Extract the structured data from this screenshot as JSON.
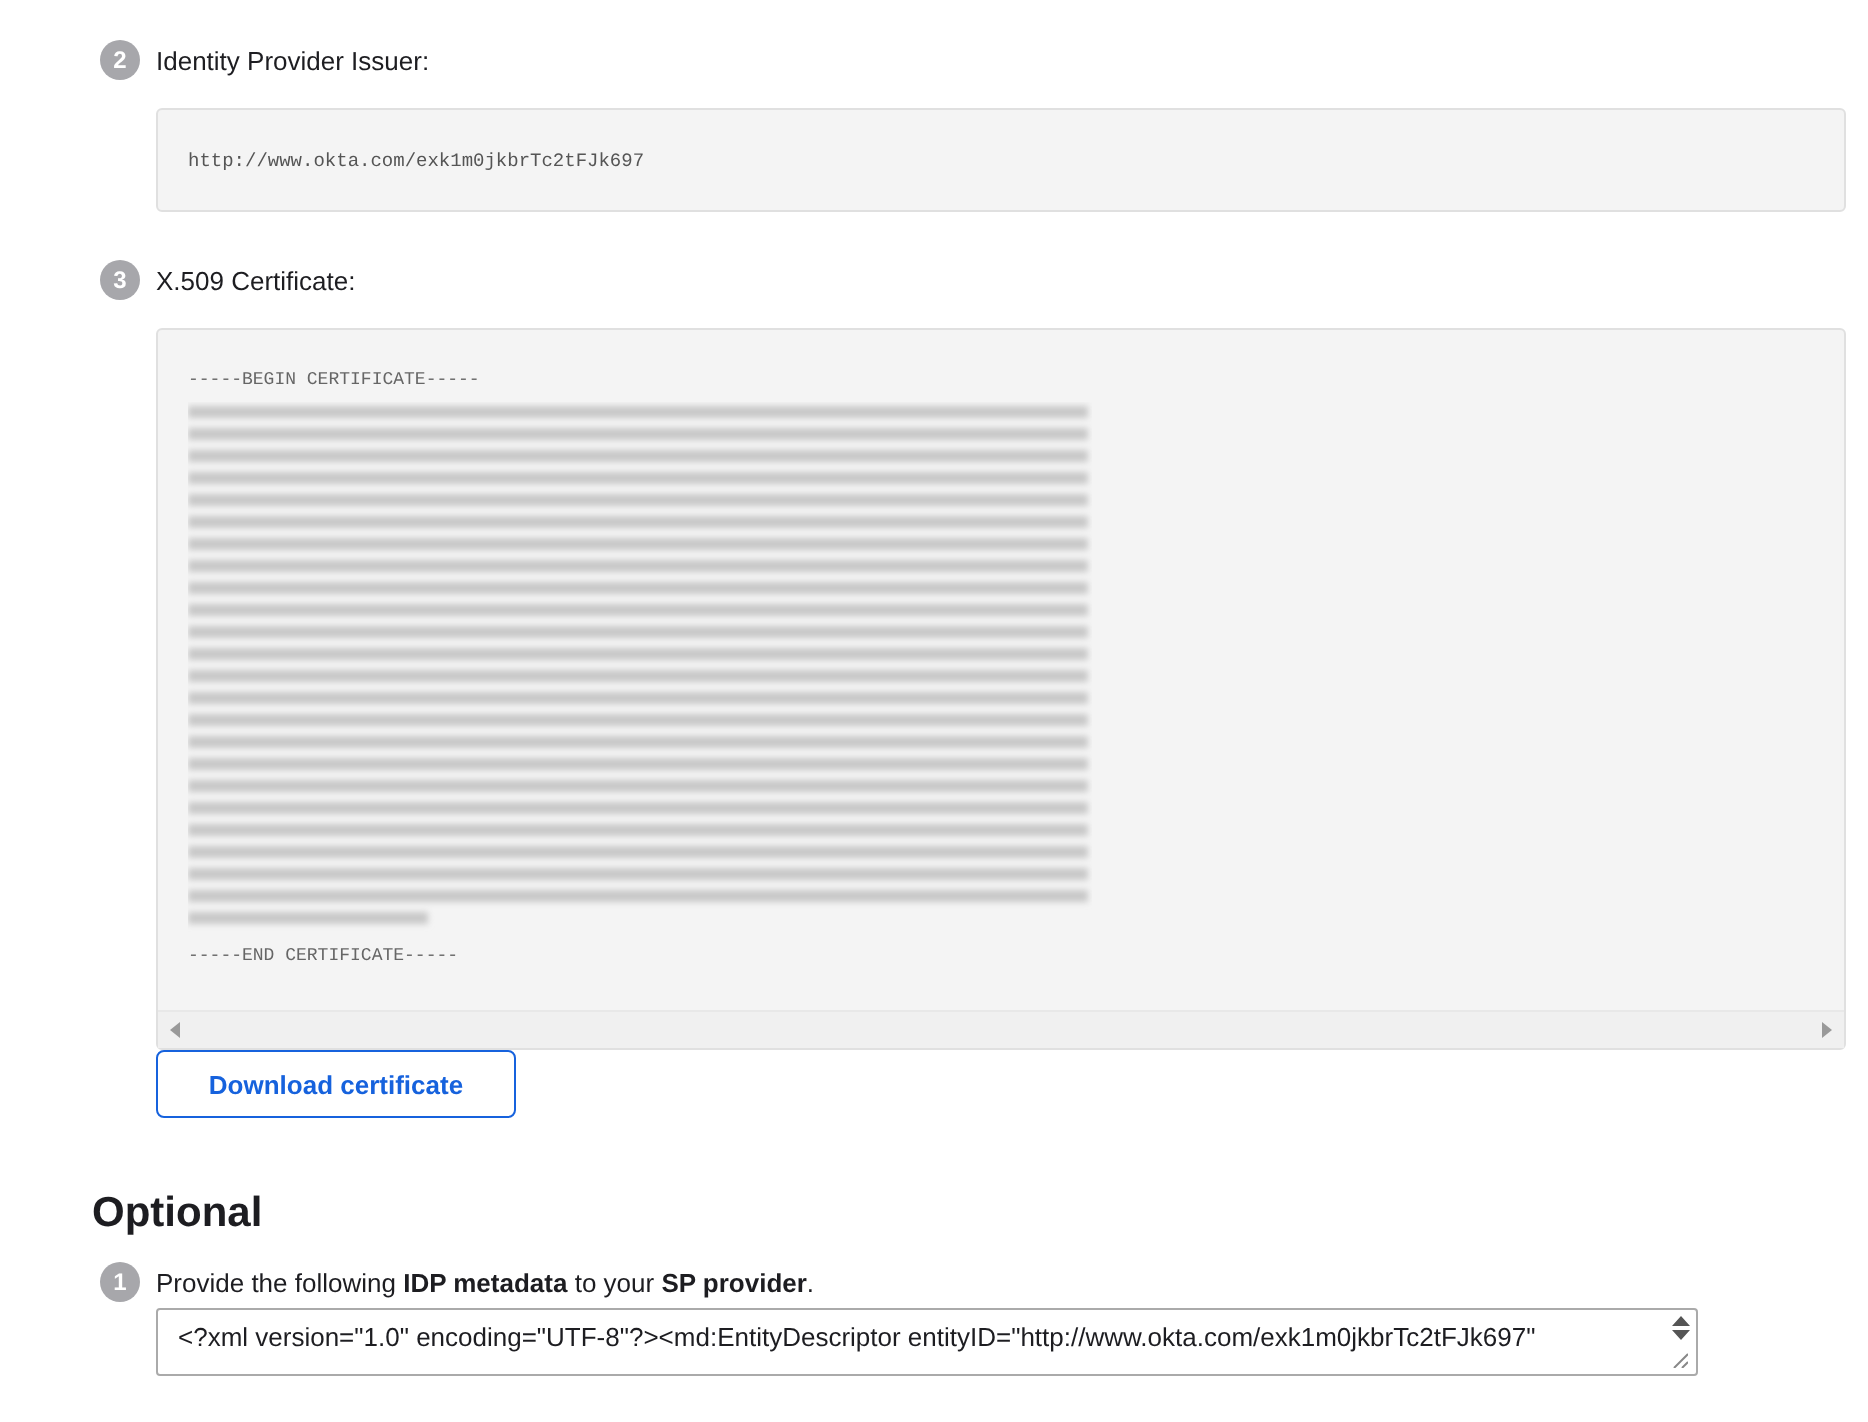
{
  "steps": [
    {
      "number": "2",
      "label": "Identity Provider Issuer:",
      "kind": "field",
      "value": "http://www.okta.com/exk1m0jkbrTc2tFJk697"
    },
    {
      "number": "3",
      "label": "X.509 Certificate:",
      "kind": "certificate",
      "begin": "-----BEGIN CERTIFICATE-----",
      "end": "-----END CERTIFICATE-----",
      "button": "Download certificate"
    }
  ],
  "optional": {
    "title": "Optional",
    "number": "1",
    "instruction": "Provide the following **IDP metadata** to your **SP provider**.",
    "metadata": "<?xml version=\"1.0\" encoding=\"UTF-8\"?><md:EntityDescriptor entityID=\"http://www.okta.com/exk1m0jkbrTc2tFJk697\""
  }
}
